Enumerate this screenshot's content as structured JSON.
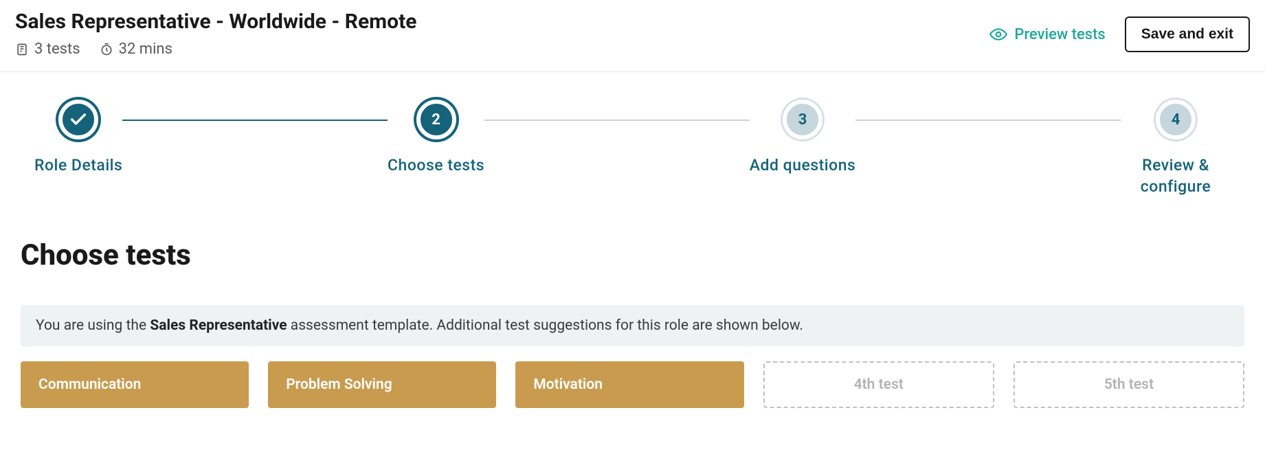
{
  "header": {
    "title": "Sales Representative - Worldwide - Remote",
    "tests_count": "3 tests",
    "duration": "32 mins",
    "preview_label": "Preview tests",
    "save_label": "Save and exit"
  },
  "stepper": {
    "steps": [
      {
        "label": "Role Details",
        "state": "done",
        "num": ""
      },
      {
        "label": "Choose tests",
        "state": "active",
        "num": "2"
      },
      {
        "label": "Add questions",
        "state": "pending",
        "num": "3"
      },
      {
        "label": "Review & configure",
        "state": "pending",
        "num": "4"
      }
    ]
  },
  "main": {
    "heading": "Choose tests",
    "banner_pre": "You are using the ",
    "banner_bold": "Sales Representative",
    "banner_post": " assessment template. Additional test suggestions for this role are shown below.",
    "tests": [
      {
        "label": "Communication",
        "type": "filled"
      },
      {
        "label": "Problem Solving",
        "type": "filled"
      },
      {
        "label": "Motivation",
        "type": "filled"
      },
      {
        "label": "4th test",
        "type": "empty"
      },
      {
        "label": "5th test",
        "type": "empty"
      }
    ]
  }
}
